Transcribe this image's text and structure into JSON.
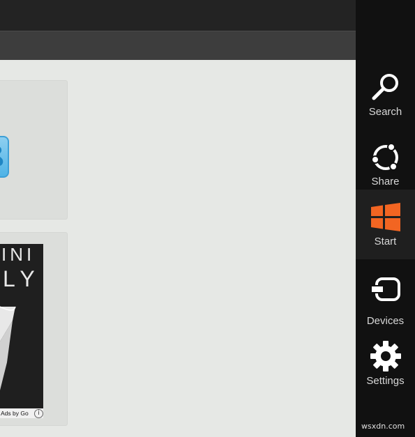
{
  "charms": {
    "search": {
      "label": "Search",
      "icon": "search-icon"
    },
    "share": {
      "label": "Share",
      "icon": "share-icon"
    },
    "start": {
      "label": "Start",
      "icon": "windows-logo-icon"
    },
    "devices": {
      "label": "Devices",
      "icon": "devices-icon"
    },
    "settings": {
      "label": "Settings",
      "icon": "gear-icon"
    }
  },
  "ad": {
    "line1": "INI",
    "line2": "LY",
    "caption": "Ads by Go",
    "info_glyph": "i"
  },
  "watermark": "wsxdn.com",
  "colors": {
    "charm_bar": "#111111",
    "start_accent": "#f26522",
    "content_bg": "#e6e8e5"
  }
}
